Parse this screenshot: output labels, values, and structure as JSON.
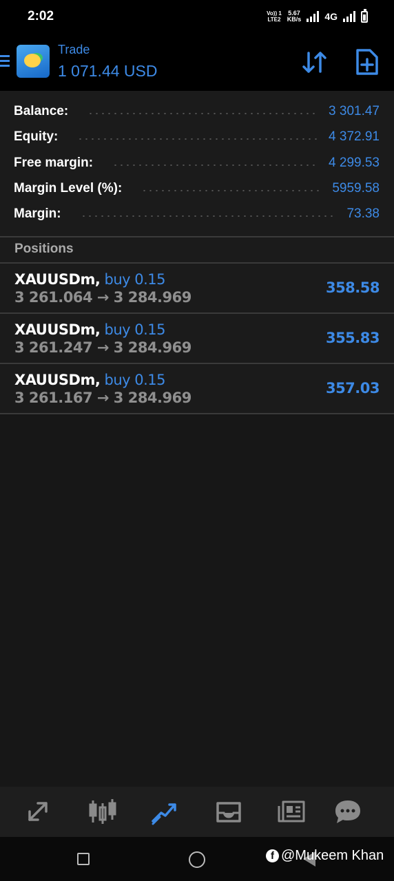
{
  "status_bar": {
    "time": "2:02",
    "volte_top": "Vo)) 1",
    "volte_bottom": "LTE2",
    "speed_top": "5.67",
    "speed_bottom": "KB/s",
    "network": "4G"
  },
  "header": {
    "title": "Trade",
    "balance": "1 071.44 USD"
  },
  "summary": [
    {
      "label": "Balance:",
      "value": "3 301.47"
    },
    {
      "label": "Equity:",
      "value": "4 372.91"
    },
    {
      "label": "Free margin:",
      "value": "4 299.53"
    },
    {
      "label": "Margin Level (%):",
      "value": "5959.58"
    },
    {
      "label": "Margin:",
      "value": "73.38"
    }
  ],
  "positions_heading": "Positions",
  "positions": [
    {
      "symbol": "XAUUSDm,",
      "type": "buy 0.15",
      "prices": "3 261.064 → 3 284.969",
      "profit": "358.58"
    },
    {
      "symbol": "XAUUSDm,",
      "type": "buy 0.15",
      "prices": "3 261.247 → 3 284.969",
      "profit": "355.83"
    },
    {
      "symbol": "XAUUSDm,",
      "type": "buy 0.15",
      "prices": "3 261.167 → 3 284.969",
      "profit": "357.03"
    }
  ],
  "tabs": [
    {
      "icon": "quotes-icon",
      "active": false
    },
    {
      "icon": "chart-icon",
      "active": false
    },
    {
      "icon": "trade-icon",
      "active": true
    },
    {
      "icon": "history-icon",
      "active": false
    },
    {
      "icon": "news-icon",
      "active": false
    },
    {
      "icon": "messages-icon",
      "active": false
    }
  ],
  "watermark": "@Mukeem Khan",
  "colors": {
    "accent": "#3d8ae6",
    "background": "#171717",
    "muted": "#8f8f8f"
  }
}
